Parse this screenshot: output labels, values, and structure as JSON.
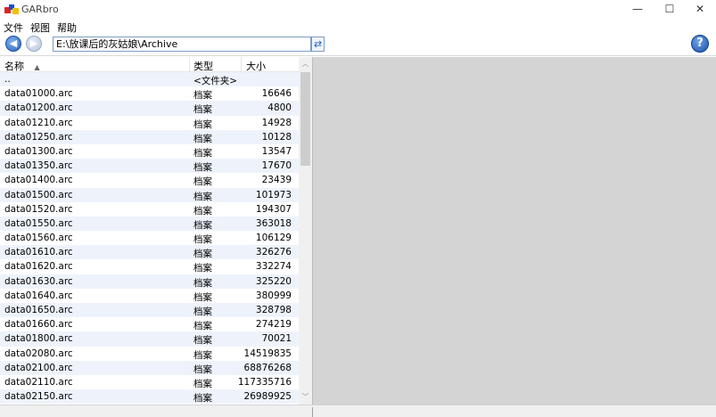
{
  "window": {
    "title": "GARbro",
    "controls": {
      "minimize": "—",
      "maximize": "☐",
      "close": "✕"
    }
  },
  "menu": [
    "文件",
    "视图",
    "帮助"
  ],
  "toolbar": {
    "path": "E:\\放课后的灰姑娘\\Archive",
    "help_label": "?"
  },
  "list": {
    "columns": {
      "name": "名称",
      "type": "类型",
      "size": "大小",
      "sort_indicator": "▲"
    },
    "rows": [
      {
        "name": "..",
        "type": "<文件夹>",
        "size": ""
      },
      {
        "name": "data01000.arc",
        "type": "档案",
        "size": "16646"
      },
      {
        "name": "data01200.arc",
        "type": "档案",
        "size": "4800"
      },
      {
        "name": "data01210.arc",
        "type": "档案",
        "size": "14928"
      },
      {
        "name": "data01250.arc",
        "type": "档案",
        "size": "10128"
      },
      {
        "name": "data01300.arc",
        "type": "档案",
        "size": "13547"
      },
      {
        "name": "data01350.arc",
        "type": "档案",
        "size": "17670"
      },
      {
        "name": "data01400.arc",
        "type": "档案",
        "size": "23439"
      },
      {
        "name": "data01500.arc",
        "type": "档案",
        "size": "101973"
      },
      {
        "name": "data01520.arc",
        "type": "档案",
        "size": "194307"
      },
      {
        "name": "data01550.arc",
        "type": "档案",
        "size": "363018"
      },
      {
        "name": "data01560.arc",
        "type": "档案",
        "size": "106129"
      },
      {
        "name": "data01610.arc",
        "type": "档案",
        "size": "326276"
      },
      {
        "name": "data01620.arc",
        "type": "档案",
        "size": "332274"
      },
      {
        "name": "data01630.arc",
        "type": "档案",
        "size": "325220"
      },
      {
        "name": "data01640.arc",
        "type": "档案",
        "size": "380999"
      },
      {
        "name": "data01650.arc",
        "type": "档案",
        "size": "328798"
      },
      {
        "name": "data01660.arc",
        "type": "档案",
        "size": "274219"
      },
      {
        "name": "data01800.arc",
        "type": "档案",
        "size": "70021"
      },
      {
        "name": "data02080.arc",
        "type": "档案",
        "size": "14519835"
      },
      {
        "name": "data02100.arc",
        "type": "档案",
        "size": "68876268"
      },
      {
        "name": "data02110.arc",
        "type": "档案",
        "size": "117335716"
      },
      {
        "name": "data02150.arc",
        "type": "档案",
        "size": "26989925"
      }
    ]
  },
  "colors": {
    "row_alt": "#eef3fb",
    "preview_bg": "#d4d4d4",
    "accent": "#2a66c4"
  }
}
